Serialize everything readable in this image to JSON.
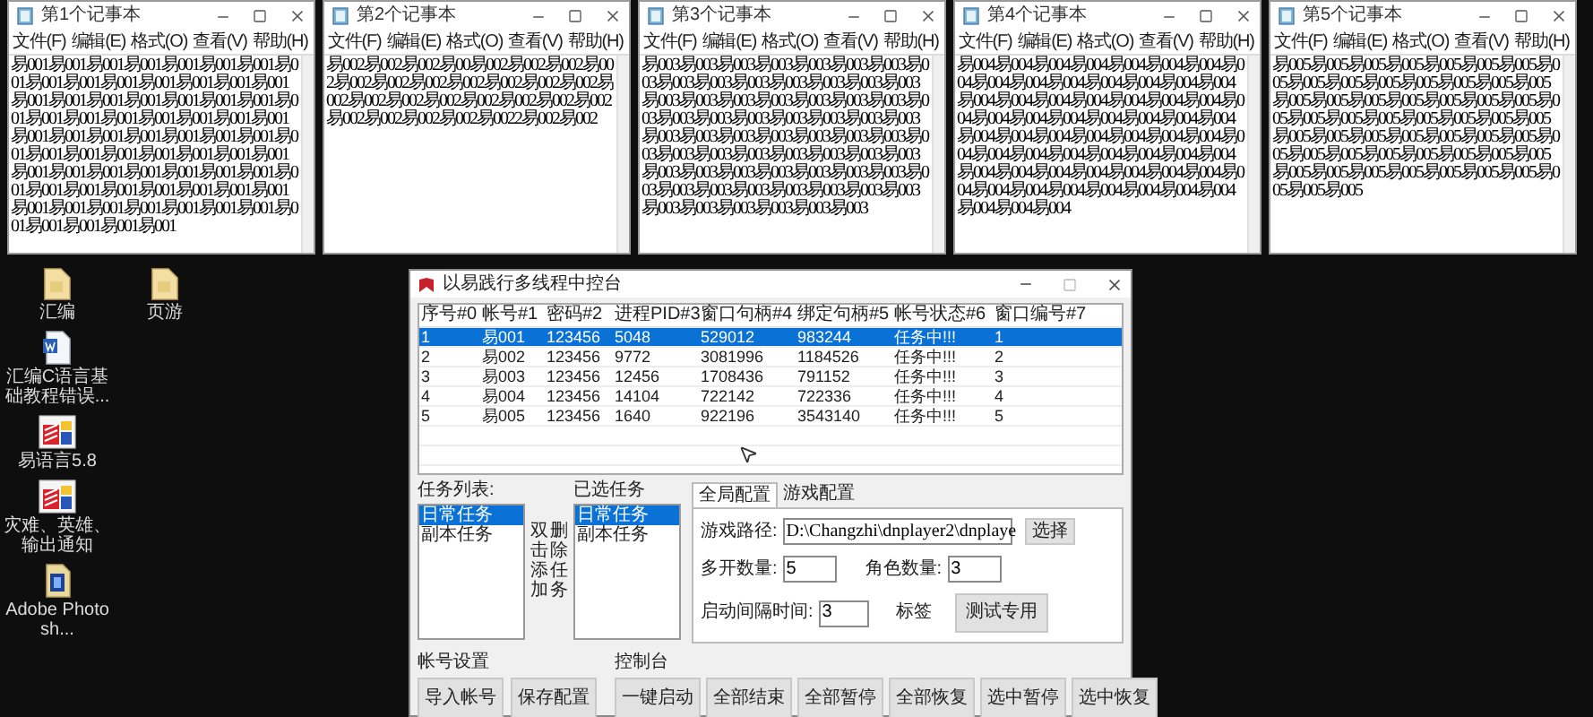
{
  "notepads": [
    {
      "title": "第1个记事本",
      "menu": [
        "文件(F)",
        "编辑(E)",
        "格式(O)",
        "查看(V)",
        "帮助(H)"
      ],
      "text": "易001易001易001易001易001易001易001易001易001易001易001易001易001易001易001易001易001易001易001易001易001易001易001易001易001易001易001易001易001易001易001易001易001易001易001易001易001易001易001易001易001易001易001易001易001易001易001易001易001易001易001易001易001易001易001易001易001易001易001易001易001易001易001易001易001易001易001易001易001易001易001易001"
    },
    {
      "title": "第2个记事本",
      "menu": [
        "文件(F)",
        "编辑(E)",
        "格式(O)",
        "查看(V)",
        "帮助(H)"
      ],
      "text": "易002易002易002易00易002易002易002易002易002易002易002易002易002易002易002易002易002易002易002易002易002易002易002易002易002易002易002易0022易002易002"
    },
    {
      "title": "第3个记事本",
      "menu": [
        "文件(F)",
        "编辑(E)",
        "格式(O)",
        "查看(V)",
        "帮助(H)"
      ],
      "text": "易003易003易003易003易003易003易003易003易003易003易003易003易003易003易003易003易003易003易003易003易003易003易003易003易003易003易003易003易003易003易003易003易003易003易003易003易003易003易003易003易003易003易003易003易003易003易003易003易003易003易003易003易003易003易003易003易003易003易003易003易003易003易003易003易003易003"
    },
    {
      "title": "第4个记事本",
      "menu": [
        "文件(F)",
        "编辑(E)",
        "格式(O)",
        "查看(V)",
        "帮助(H)"
      ],
      "text": "易004易004易004易004易004易004易004易004易004易004易004易004易004易004易004易004易004易004易004易004易004易004易004易004易004易004易004易004易004易004易004易004易004易004易004易004易004易004易004易004易004易004易004易004易004易004易004易004易004易004易004易004易004易004易004易004易004易004易004易004易004易004易004"
    },
    {
      "title": "第5个记事本",
      "menu": [
        "文件(F)",
        "编辑(E)",
        "格式(O)",
        "查看(V)",
        "帮助(H)"
      ],
      "text": "易005易005易005易005易005易005易005易005易005易005易005易005易005易005易005易005易005易005易005易005易005易005易005易005易005易005易005易005易005易005易005易005易005易005易005易005易005易005易005易005易005易005易005易005易005易005易005易005易005易005易005易005易005易005易005"
    }
  ],
  "desktop_icons": [
    {
      "label": "汇编",
      "kind": "folder"
    },
    {
      "label": "页游",
      "kind": "folder"
    },
    {
      "label": "汇编C语言基础教程错误...",
      "kind": "document"
    },
    {
      "label": "易语言5.8",
      "kind": "app"
    },
    {
      "label": "灾难、英雄、输出通知",
      "kind": "app"
    },
    {
      "label": "Adobe Photosh...",
      "kind": "photoshop"
    }
  ],
  "dialog": {
    "title": "以易践行多线程中控台",
    "table": {
      "columns": [
        "序号#0",
        "帐号#1",
        "密码#2",
        "进程PID#3",
        "窗口句柄#4",
        "绑定句柄#5",
        "帐号状态#6",
        "窗口编号#7"
      ],
      "rows": [
        {
          "selected": true,
          "cells": [
            "1",
            "易001",
            "123456",
            "5048",
            "529012",
            "983244",
            "任务中!!!",
            "1"
          ]
        },
        {
          "selected": false,
          "cells": [
            "2",
            "易002",
            "123456",
            "9772",
            "3081996",
            "1184526",
            "任务中!!!",
            "2"
          ]
        },
        {
          "selected": false,
          "cells": [
            "3",
            "易003",
            "123456",
            "12456",
            "1708436",
            "791152",
            "任务中!!!",
            "3"
          ]
        },
        {
          "selected": false,
          "cells": [
            "4",
            "易004",
            "123456",
            "14104",
            "722142",
            "722336",
            "任务中!!!",
            "4"
          ]
        },
        {
          "selected": false,
          "cells": [
            "5",
            "易005",
            "123456",
            "1640",
            "922196",
            "3543140",
            "任务中!!!",
            "5"
          ]
        }
      ]
    },
    "task_list": {
      "label": "任务列表:",
      "items": [
        {
          "label": "日常任务",
          "selected": true
        },
        {
          "label": "副本任务",
          "selected": false
        }
      ]
    },
    "hint": [
      "双击添加",
      "删除任务"
    ],
    "selected_tasks": {
      "label": "已选任务",
      "items": [
        {
          "label": "日常任务",
          "selected": true
        },
        {
          "label": "副本任务",
          "selected": false
        }
      ]
    },
    "tabs": [
      {
        "label": "全局配置",
        "selected": true
      },
      {
        "label": "游戏配置",
        "selected": false
      }
    ],
    "settings": {
      "path_label": "游戏路径:",
      "path_value": "D:\\Changzhi\\dnplayer2\\dnplaye",
      "choose_button": "选择",
      "instances_label": "多开数量:",
      "instances_value": "5",
      "roles_label": "角色数量:",
      "roles_value": "3",
      "interval_label": "启动间隔时间:",
      "interval_value": "3",
      "tag_label": "标签",
      "test_button": "测试专用"
    },
    "account_settings": {
      "label": "帐号设置",
      "buttons": [
        "导入帐号",
        "保存配置"
      ]
    },
    "console": {
      "label": "控制台",
      "buttons": [
        "一键启动",
        "全部结束",
        "全部暂停",
        "全部恢复",
        "选中暂停",
        "选中恢复"
      ]
    }
  }
}
